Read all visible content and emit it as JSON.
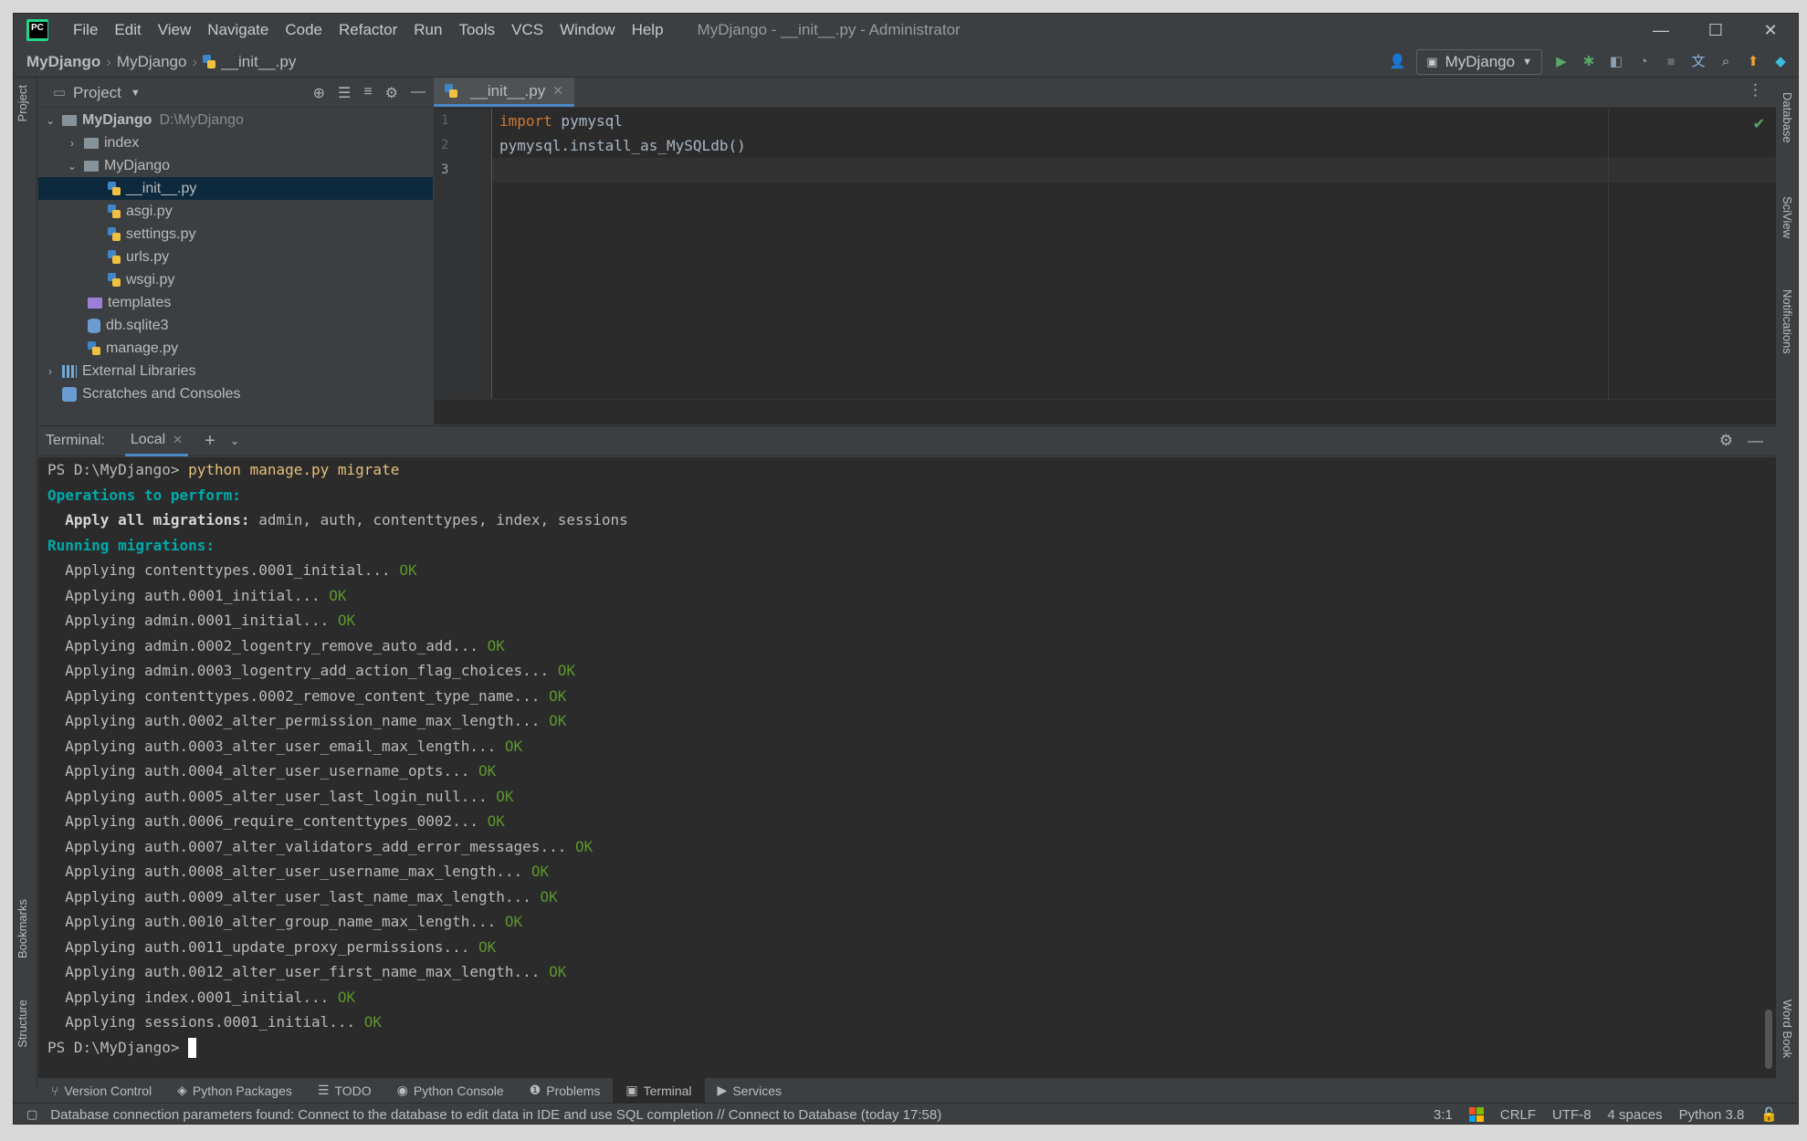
{
  "titlebar": {
    "menus": [
      "File",
      "Edit",
      "View",
      "Navigate",
      "Code",
      "Refactor",
      "Run",
      "Tools",
      "VCS",
      "Window",
      "Help"
    ],
    "title": "MyDjango - __init__.py - Administrator",
    "minimize": "—",
    "maximize": "☐",
    "close": "✕"
  },
  "navbar": {
    "crumbs": [
      "MyDjango",
      "MyDjango",
      "__init__.py"
    ],
    "run_config": "MyDjango"
  },
  "project": {
    "title": "Project",
    "root": {
      "name": "MyDjango",
      "path": "D:\\MyDjango"
    },
    "items": [
      {
        "name": "index"
      },
      {
        "name": "MyDjango"
      },
      {
        "name": "__init__.py"
      },
      {
        "name": "asgi.py"
      },
      {
        "name": "settings.py"
      },
      {
        "name": "urls.py"
      },
      {
        "name": "wsgi.py"
      },
      {
        "name": "templates"
      },
      {
        "name": "db.sqlite3"
      },
      {
        "name": "manage.py"
      },
      {
        "name": "External Libraries"
      },
      {
        "name": "Scratches and Consoles"
      }
    ]
  },
  "editor": {
    "tab": "__init__.py",
    "line_numbers": [
      "1",
      "2",
      "3"
    ],
    "lines": [
      {
        "kw": "import",
        "rest": " pymysql"
      },
      {
        "kw": "",
        "rest": "pymysql.install_as_MySQLdb()"
      },
      {
        "kw": "",
        "rest": ""
      }
    ]
  },
  "terminal": {
    "label": "Terminal:",
    "tab": "Local",
    "prompt": "PS D:\\MyDjango>",
    "command": "python manage.py migrate",
    "ops_header": "Operations to perform:",
    "apply_label": "Apply all migrations:",
    "apply_value": " admin, auth, contenttypes, index, sessions",
    "running_header": "Running migrations:",
    "ok": "OK",
    "migrations": [
      "Applying contenttypes.0001_initial...",
      "Applying auth.0001_initial...",
      "Applying admin.0001_initial...",
      "Applying admin.0002_logentry_remove_auto_add...",
      "Applying admin.0003_logentry_add_action_flag_choices...",
      "Applying contenttypes.0002_remove_content_type_name...",
      "Applying auth.0002_alter_permission_name_max_length...",
      "Applying auth.0003_alter_user_email_max_length...",
      "Applying auth.0004_alter_user_username_opts...",
      "Applying auth.0005_alter_user_last_login_null...",
      "Applying auth.0006_require_contenttypes_0002...",
      "Applying auth.0007_alter_validators_add_error_messages...",
      "Applying auth.0008_alter_user_username_max_length...",
      "Applying auth.0009_alter_user_last_name_max_length...",
      "Applying auth.0010_alter_group_name_max_length...",
      "Applying auth.0011_update_proxy_permissions...",
      "Applying auth.0012_alter_user_first_name_max_length...",
      "Applying index.0001_initial...",
      "Applying sessions.0001_initial..."
    ]
  },
  "toolwindows": [
    "Version Control",
    "Python Packages",
    "TODO",
    "Python Console",
    "Problems",
    "Terminal",
    "Services"
  ],
  "sidebars": {
    "left": [
      "Project",
      "Bookmarks",
      "Structure"
    ],
    "right": [
      "Database",
      "SciView",
      "Notifications",
      "Word Book"
    ]
  },
  "status": {
    "message": "Database connection parameters found: Connect to the database to edit data in IDE and use SQL completion // Connect to Database (today 17:58)",
    "position": "3:1",
    "line_sep": "CRLF",
    "encoding": "UTF-8",
    "indent": "4 spaces",
    "interpreter": "Python 3.8"
  },
  "colors": {
    "accent": "#4a88c7",
    "ok": "#5c962c",
    "cyan": "#00aaaa",
    "keyword": "#cc7832"
  }
}
